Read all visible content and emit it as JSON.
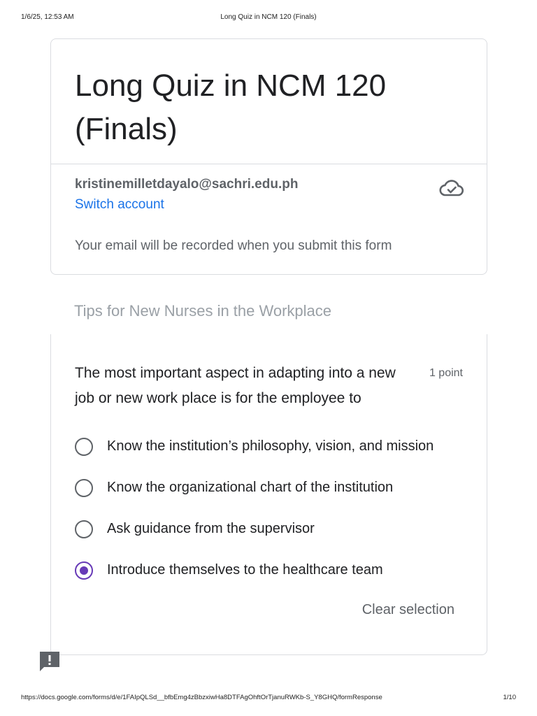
{
  "print_header": {
    "datetime": "1/6/25, 12:53 AM",
    "doc_title": "Long Quiz in NCM 120 (Finals)"
  },
  "form": {
    "title": "Long Quiz in NCM 120 (Finals)",
    "account_email": "kristinemilletdayalo@sachri.edu.ph",
    "switch_account": "Switch account",
    "email_note": "Your email will be recorded when you submit this form",
    "cloud_icon": "cloud-done-icon"
  },
  "section": {
    "title": "Tips for New Nurses in the Workplace"
  },
  "question": {
    "text": "The most important aspect in adapting into a new job or new work place is for the employee to",
    "points": "1 point",
    "options": [
      {
        "label": "Know the institution’s philosophy, vision, and mission",
        "selected": false
      },
      {
        "label": "Know the organizational chart of the institution",
        "selected": false
      },
      {
        "label": "Ask guidance from the supervisor",
        "selected": false
      },
      {
        "label": "Introduce themselves to the healthcare team",
        "selected": true
      }
    ],
    "clear_selection": "Clear selection"
  },
  "print_footer": {
    "url": "https://docs.google.com/forms/d/e/1FAIpQLSd__bfbEmg4zBbzxiwHa8DTFAgOhftOrTjanuRWKb-S_Y8GHQ/formResponse",
    "page": "1/10"
  },
  "colors": {
    "accent": "#673ab7",
    "link": "#1a73e8",
    "border": "#dadce0",
    "muted_text": "#5f6368"
  },
  "icons": {
    "feedback": "report-feedback-icon"
  }
}
